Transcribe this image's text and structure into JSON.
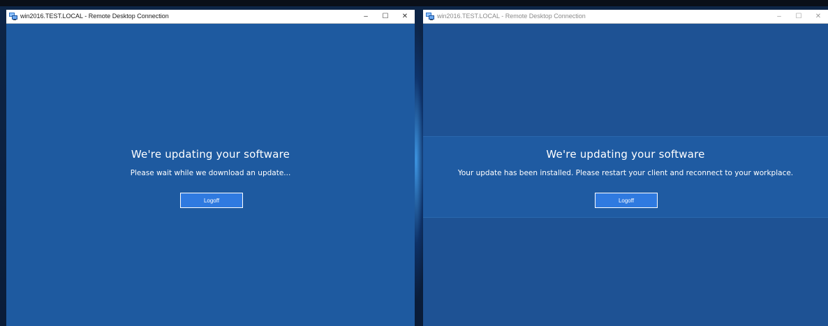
{
  "colors": {
    "content_background": "#1e5aa0",
    "button_background": "#2f7ae0",
    "text": "#ffffff"
  },
  "windows": [
    {
      "title": "win2016.TEST.LOCAL - Remote Desktop Connection",
      "active": true,
      "controls": {
        "minimize": "–",
        "maximize": "☐",
        "close": "✕"
      },
      "heading": "We're updating your software",
      "message": "Please wait while we download an update...",
      "button_label": "Logoff"
    },
    {
      "title": "win2016.TEST.LOCAL - Remote Desktop Connection",
      "active": false,
      "controls": {
        "minimize": "–",
        "maximize": "☐",
        "close": "✕"
      },
      "heading": "We're updating your software",
      "message": "Your update has been installed. Please restart your client and reconnect to your workplace.",
      "button_label": "Logoff"
    }
  ]
}
